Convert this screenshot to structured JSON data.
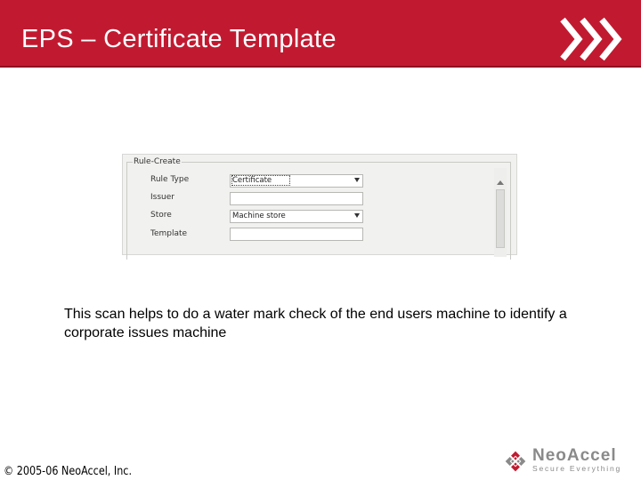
{
  "slide": {
    "title": "EPS – Certificate Template",
    "body": "This scan helps to do a water mark check of the end users machine to identify a corporate issues machine",
    "footer": "© 2005-06 NeoAccel, Inc."
  },
  "form": {
    "legend": "Rule-Create",
    "fields": [
      {
        "label": "Rule Type",
        "value": "Certificate",
        "kind": "dropdown"
      },
      {
        "label": "Issuer",
        "value": "",
        "kind": "text"
      },
      {
        "label": "Store",
        "value": "Machine store",
        "kind": "dropdown"
      },
      {
        "label": "Template",
        "value": "",
        "kind": "text"
      }
    ]
  },
  "logo": {
    "name": "NeoAccel",
    "tagline": "Secure Everything",
    "icon": "neoaccel-logo-icon"
  },
  "colors": {
    "title_bar": "#c11a30",
    "logo_gray": "#8a8a8a",
    "logo_red": "#c11a30"
  }
}
